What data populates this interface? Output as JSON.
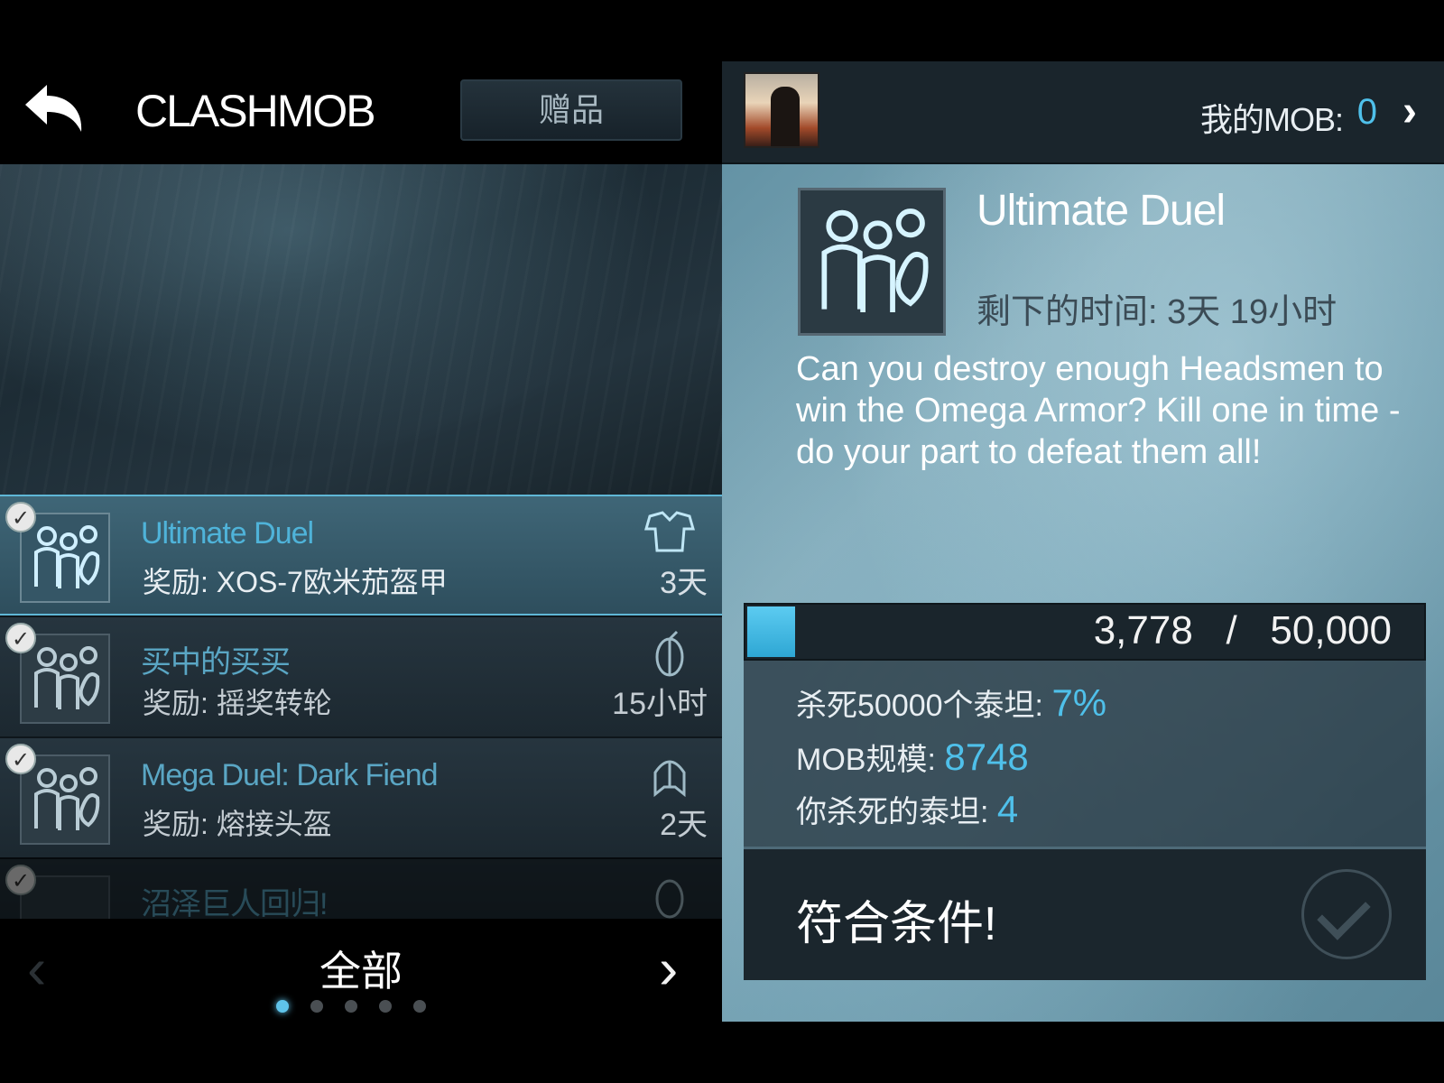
{
  "header": {
    "title": "CLASHMOB",
    "gift_label": "赠品"
  },
  "filter": {
    "label": "全部",
    "pages": 5,
    "active_page": 0
  },
  "list": [
    {
      "name": "Ultimate Duel",
      "reward": "奖励: XOS-7欧米茄盔甲",
      "time": "3天",
      "reward_icon": "armor-icon",
      "selected": true
    },
    {
      "name": "买中的买买",
      "reward": "奖励: 摇奖转轮",
      "time": "15小时",
      "reward_icon": "spin-wheel-icon",
      "selected": false
    },
    {
      "name": "Mega Duel: Dark Fiend",
      "reward": "奖励: 熔接头盔",
      "time": "2天",
      "reward_icon": "helmet-icon",
      "selected": false
    },
    {
      "name": "沼泽巨人回归!",
      "reward": "",
      "time": "",
      "reward_icon": "spin-wheel-icon",
      "selected": false
    }
  ],
  "detail": {
    "my_mob_label": "我的MOB:",
    "my_mob_value": "0",
    "title": "Ultimate Duel",
    "time_remaining": "剩下的时间: 3天 19小时",
    "description": "Can you destroy enough Headsmen to win the Omega Armor? Kill one in time - do your part to defeat them all!",
    "progress": {
      "current": "3,778",
      "separator": "/",
      "total": "50,000",
      "fraction": 0.07
    },
    "stats": [
      {
        "label": "杀死50000个泰坦:",
        "value": "7%"
      },
      {
        "label": "MOB规模:",
        "value": "8748"
      },
      {
        "label": "你杀死的泰坦:",
        "value": "4"
      }
    ],
    "eligible_label": "符合条件!"
  }
}
